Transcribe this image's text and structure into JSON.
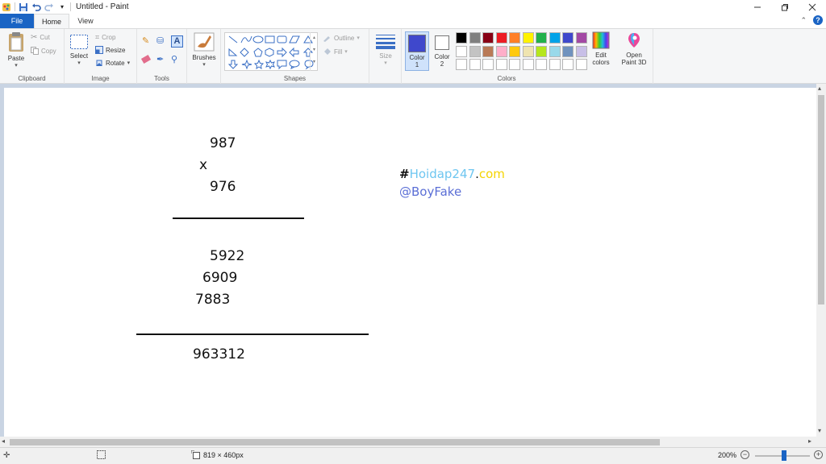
{
  "window": {
    "title": "Untitled - Paint",
    "controls": [
      "minimize-icon",
      "restore-icon",
      "close-icon"
    ]
  },
  "tabs": {
    "file": "File",
    "home": "Home",
    "view": "View"
  },
  "ribbon": {
    "clipboard": {
      "paste": "Paste",
      "cut": "Cut",
      "copy": "Copy",
      "label": "Clipboard"
    },
    "image": {
      "select": "Select",
      "crop": "Crop",
      "resize": "Resize",
      "rotate": "Rotate",
      "label": "Image"
    },
    "tools": {
      "label": "Tools"
    },
    "brushes": {
      "label": "Brushes"
    },
    "shapes": {
      "outline": "Outline",
      "fill": "Fill",
      "label": "Shapes"
    },
    "size": {
      "label": "Size"
    },
    "colors": {
      "color1": "Color",
      "color1_num": "1",
      "color2": "Color",
      "color2_num": "2",
      "edit_colors": "Edit colors",
      "open_paint3d": "Open Paint 3D",
      "label": "Colors",
      "color1_value": "#3f48cc",
      "color2_value": "#ffffff",
      "palette_row1": [
        "#000000",
        "#7f7f7f",
        "#880015",
        "#ed1c24",
        "#ff7f27",
        "#fff200",
        "#22b14c",
        "#00a2e8",
        "#3f48cc",
        "#a349a4"
      ],
      "palette_row2": [
        "#ffffff",
        "#c3c3c3",
        "#b97a57",
        "#ffaec9",
        "#ffc90e",
        "#efe4b0",
        "#b5e61d",
        "#99d9ea",
        "#7092be",
        "#c8bfe7"
      ],
      "palette_row3": [
        "#ffffff",
        "#ffffff",
        "#ffffff",
        "#ffffff",
        "#ffffff",
        "#ffffff",
        "#ffffff",
        "#ffffff",
        "#ffffff",
        "#ffffff"
      ]
    }
  },
  "canvas": {
    "lines": {
      "multiplicand": "987",
      "operator": "x",
      "multiplier": "976",
      "partial1": "5922",
      "partial2": "6909",
      "partial3": "7883",
      "result": "963312"
    },
    "watermark": {
      "hash": "#",
      "brand_part1": "Hoidap247",
      "dot": ".",
      "brand_part2": "com",
      "handle": "@BoyFake"
    }
  },
  "statusbar": {
    "dimensions": "819 × 460px",
    "zoom": "200%"
  }
}
